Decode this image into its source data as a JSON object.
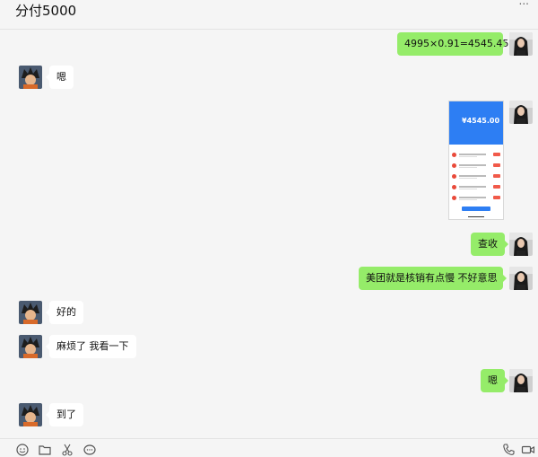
{
  "chat": {
    "title": "分付5000",
    "menu_label": "..."
  },
  "messages": [
    {
      "side": "right",
      "type": "text",
      "text": "4995×0.91=4545.45"
    },
    {
      "side": "left",
      "type": "text",
      "text": "嗯"
    },
    {
      "side": "right",
      "type": "image",
      "image": {
        "amount": "¥4545.00"
      }
    },
    {
      "side": "right",
      "type": "text",
      "text": "查收"
    },
    {
      "side": "right",
      "type": "text",
      "text": "美团就是核销有点慢  不好意思"
    },
    {
      "side": "left",
      "type": "text",
      "text": "好的"
    },
    {
      "side": "left",
      "type": "text",
      "text": "麻烦了 我看一下"
    },
    {
      "side": "right",
      "type": "text",
      "text": "嗯"
    },
    {
      "side": "left",
      "type": "text",
      "text": "到了"
    }
  ],
  "toolbar": {
    "left_icons": [
      "emoji-icon",
      "folder-icon",
      "scissors-icon",
      "chat-bubble-icon"
    ],
    "right_icons": [
      "phone-icon",
      "video-icon"
    ]
  },
  "colors": {
    "my_bubble": "#95ec69",
    "their_bubble": "#ffffff",
    "background": "#f5f5f5"
  }
}
